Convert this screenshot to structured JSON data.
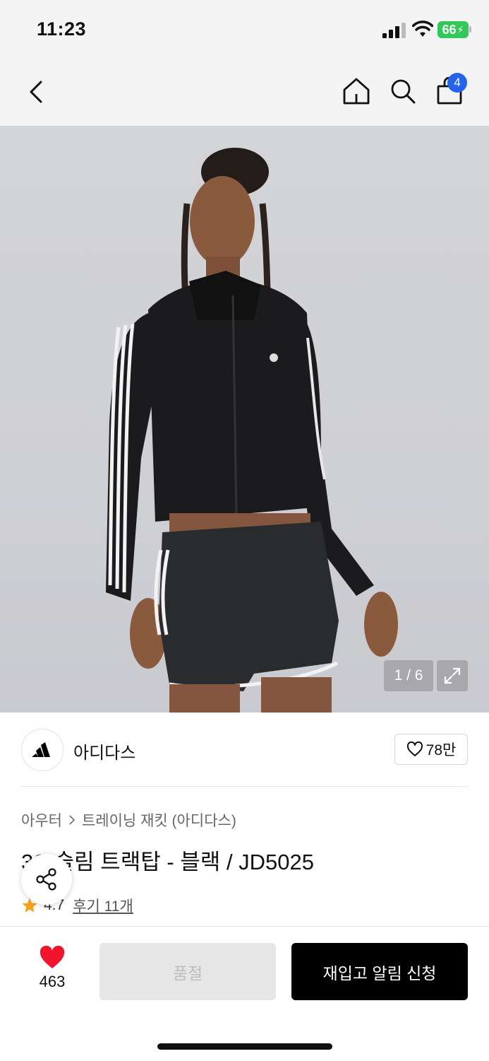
{
  "status_bar": {
    "time": "11:23",
    "battery": "66",
    "icons": [
      "signal-icon",
      "wifi-icon",
      "battery-icon"
    ]
  },
  "nav": {
    "cart_count": "4",
    "icons": [
      "back-arrow-icon",
      "home-icon",
      "search-icon",
      "shopping-bag-icon"
    ]
  },
  "gallery": {
    "counter": "1 / 6",
    "icons": [
      "expand-icon"
    ]
  },
  "brand": {
    "name": "아디다스",
    "likes": "78만",
    "icons": [
      "adidas-logo",
      "heart-outline-icon"
    ]
  },
  "product": {
    "breadcrumb": [
      "아우터",
      "트레이닝 재킷 (아디다스)"
    ],
    "title": "3S 슬림 트랙탑 - 블랙 / JD5025",
    "rating": "4.7",
    "reviews": "후기 11개",
    "icons": [
      "star-icon",
      "share-icon",
      "chevron-right-icon"
    ]
  },
  "bottom_bar": {
    "wish_count": "463",
    "soldout_label": "품절",
    "restock_label": "재입고 알림 신청",
    "icons": [
      "heart-filled-icon"
    ]
  },
  "colors": {
    "accent_blue": "#2463eb",
    "heart_red": "#f0142f",
    "star_orange": "#f5a31a",
    "battery_green": "#34c759"
  }
}
